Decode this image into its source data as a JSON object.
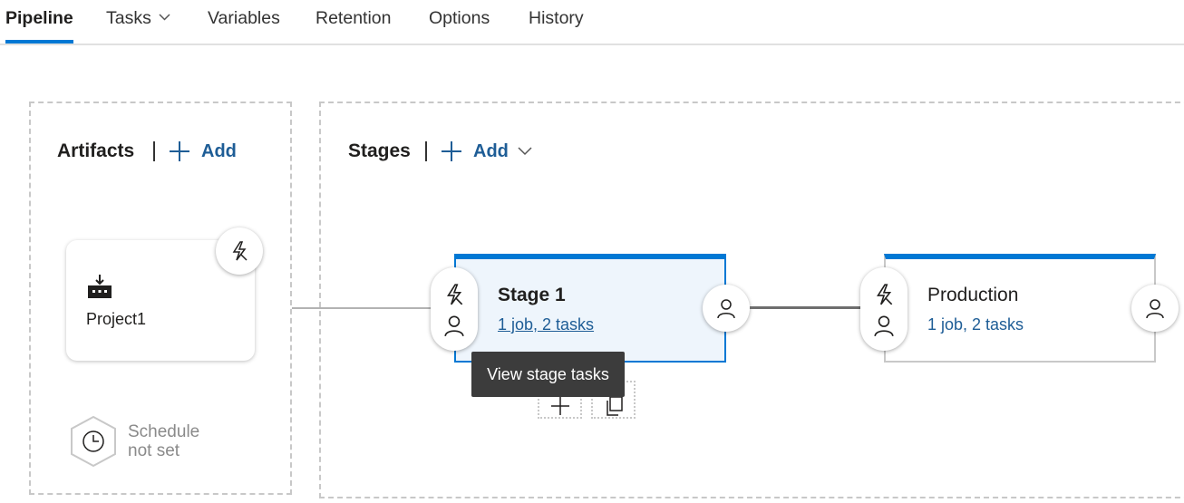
{
  "tabs": [
    {
      "label": "Pipeline",
      "active": true
    },
    {
      "label": "Tasks",
      "has_dropdown": true
    },
    {
      "label": "Variables"
    },
    {
      "label": "Retention"
    },
    {
      "label": "Options"
    },
    {
      "label": "History"
    }
  ],
  "artifacts": {
    "title": "Artifacts",
    "add_label": "Add",
    "items": [
      {
        "name": "Project1",
        "icon": "build-artifact-icon"
      }
    ],
    "schedule": {
      "line1": "Schedule",
      "line2": "not set",
      "icon": "clock-icon"
    }
  },
  "stages": {
    "title": "Stages",
    "add_label": "Add",
    "items": [
      {
        "name": "Stage 1",
        "summary": "1 job, 2 tasks",
        "selected": true
      },
      {
        "name": "Production",
        "summary": "1 job, 2 tasks",
        "selected": false
      }
    ]
  },
  "tooltip": "View stage tasks",
  "colors": {
    "accent": "#0078d4",
    "link": "#1e5d96",
    "selected_bg": "#eef5fc",
    "tooltip_bg": "#3c3c3c"
  }
}
